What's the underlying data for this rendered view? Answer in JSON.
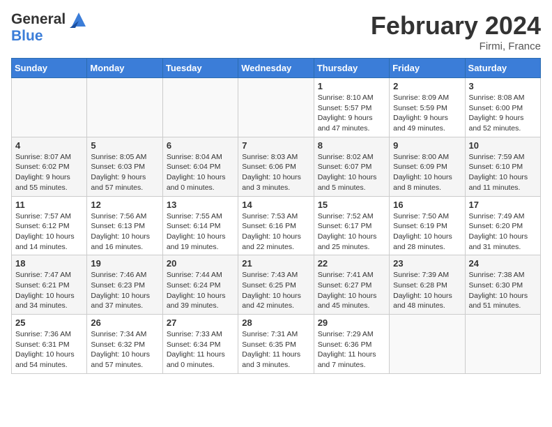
{
  "header": {
    "logo": {
      "general": "General",
      "blue": "Blue"
    },
    "title": "February 2024",
    "location": "Firmi, France"
  },
  "days_of_week": [
    "Sunday",
    "Monday",
    "Tuesday",
    "Wednesday",
    "Thursday",
    "Friday",
    "Saturday"
  ],
  "weeks": [
    [
      {
        "day": "",
        "info": ""
      },
      {
        "day": "",
        "info": ""
      },
      {
        "day": "",
        "info": ""
      },
      {
        "day": "",
        "info": ""
      },
      {
        "day": "1",
        "info": "Sunrise: 8:10 AM\nSunset: 5:57 PM\nDaylight: 9 hours and 47 minutes."
      },
      {
        "day": "2",
        "info": "Sunrise: 8:09 AM\nSunset: 5:59 PM\nDaylight: 9 hours and 49 minutes."
      },
      {
        "day": "3",
        "info": "Sunrise: 8:08 AM\nSunset: 6:00 PM\nDaylight: 9 hours and 52 minutes."
      }
    ],
    [
      {
        "day": "4",
        "info": "Sunrise: 8:07 AM\nSunset: 6:02 PM\nDaylight: 9 hours and 55 minutes."
      },
      {
        "day": "5",
        "info": "Sunrise: 8:05 AM\nSunset: 6:03 PM\nDaylight: 9 hours and 57 minutes."
      },
      {
        "day": "6",
        "info": "Sunrise: 8:04 AM\nSunset: 6:04 PM\nDaylight: 10 hours and 0 minutes."
      },
      {
        "day": "7",
        "info": "Sunrise: 8:03 AM\nSunset: 6:06 PM\nDaylight: 10 hours and 3 minutes."
      },
      {
        "day": "8",
        "info": "Sunrise: 8:02 AM\nSunset: 6:07 PM\nDaylight: 10 hours and 5 minutes."
      },
      {
        "day": "9",
        "info": "Sunrise: 8:00 AM\nSunset: 6:09 PM\nDaylight: 10 hours and 8 minutes."
      },
      {
        "day": "10",
        "info": "Sunrise: 7:59 AM\nSunset: 6:10 PM\nDaylight: 10 hours and 11 minutes."
      }
    ],
    [
      {
        "day": "11",
        "info": "Sunrise: 7:57 AM\nSunset: 6:12 PM\nDaylight: 10 hours and 14 minutes."
      },
      {
        "day": "12",
        "info": "Sunrise: 7:56 AM\nSunset: 6:13 PM\nDaylight: 10 hours and 16 minutes."
      },
      {
        "day": "13",
        "info": "Sunrise: 7:55 AM\nSunset: 6:14 PM\nDaylight: 10 hours and 19 minutes."
      },
      {
        "day": "14",
        "info": "Sunrise: 7:53 AM\nSunset: 6:16 PM\nDaylight: 10 hours and 22 minutes."
      },
      {
        "day": "15",
        "info": "Sunrise: 7:52 AM\nSunset: 6:17 PM\nDaylight: 10 hours and 25 minutes."
      },
      {
        "day": "16",
        "info": "Sunrise: 7:50 AM\nSunset: 6:19 PM\nDaylight: 10 hours and 28 minutes."
      },
      {
        "day": "17",
        "info": "Sunrise: 7:49 AM\nSunset: 6:20 PM\nDaylight: 10 hours and 31 minutes."
      }
    ],
    [
      {
        "day": "18",
        "info": "Sunrise: 7:47 AM\nSunset: 6:21 PM\nDaylight: 10 hours and 34 minutes."
      },
      {
        "day": "19",
        "info": "Sunrise: 7:46 AM\nSunset: 6:23 PM\nDaylight: 10 hours and 37 minutes."
      },
      {
        "day": "20",
        "info": "Sunrise: 7:44 AM\nSunset: 6:24 PM\nDaylight: 10 hours and 39 minutes."
      },
      {
        "day": "21",
        "info": "Sunrise: 7:43 AM\nSunset: 6:25 PM\nDaylight: 10 hours and 42 minutes."
      },
      {
        "day": "22",
        "info": "Sunrise: 7:41 AM\nSunset: 6:27 PM\nDaylight: 10 hours and 45 minutes."
      },
      {
        "day": "23",
        "info": "Sunrise: 7:39 AM\nSunset: 6:28 PM\nDaylight: 10 hours and 48 minutes."
      },
      {
        "day": "24",
        "info": "Sunrise: 7:38 AM\nSunset: 6:30 PM\nDaylight: 10 hours and 51 minutes."
      }
    ],
    [
      {
        "day": "25",
        "info": "Sunrise: 7:36 AM\nSunset: 6:31 PM\nDaylight: 10 hours and 54 minutes."
      },
      {
        "day": "26",
        "info": "Sunrise: 7:34 AM\nSunset: 6:32 PM\nDaylight: 10 hours and 57 minutes."
      },
      {
        "day": "27",
        "info": "Sunrise: 7:33 AM\nSunset: 6:34 PM\nDaylight: 11 hours and 0 minutes."
      },
      {
        "day": "28",
        "info": "Sunrise: 7:31 AM\nSunset: 6:35 PM\nDaylight: 11 hours and 3 minutes."
      },
      {
        "day": "29",
        "info": "Sunrise: 7:29 AM\nSunset: 6:36 PM\nDaylight: 11 hours and 7 minutes."
      },
      {
        "day": "",
        "info": ""
      },
      {
        "day": "",
        "info": ""
      }
    ]
  ]
}
